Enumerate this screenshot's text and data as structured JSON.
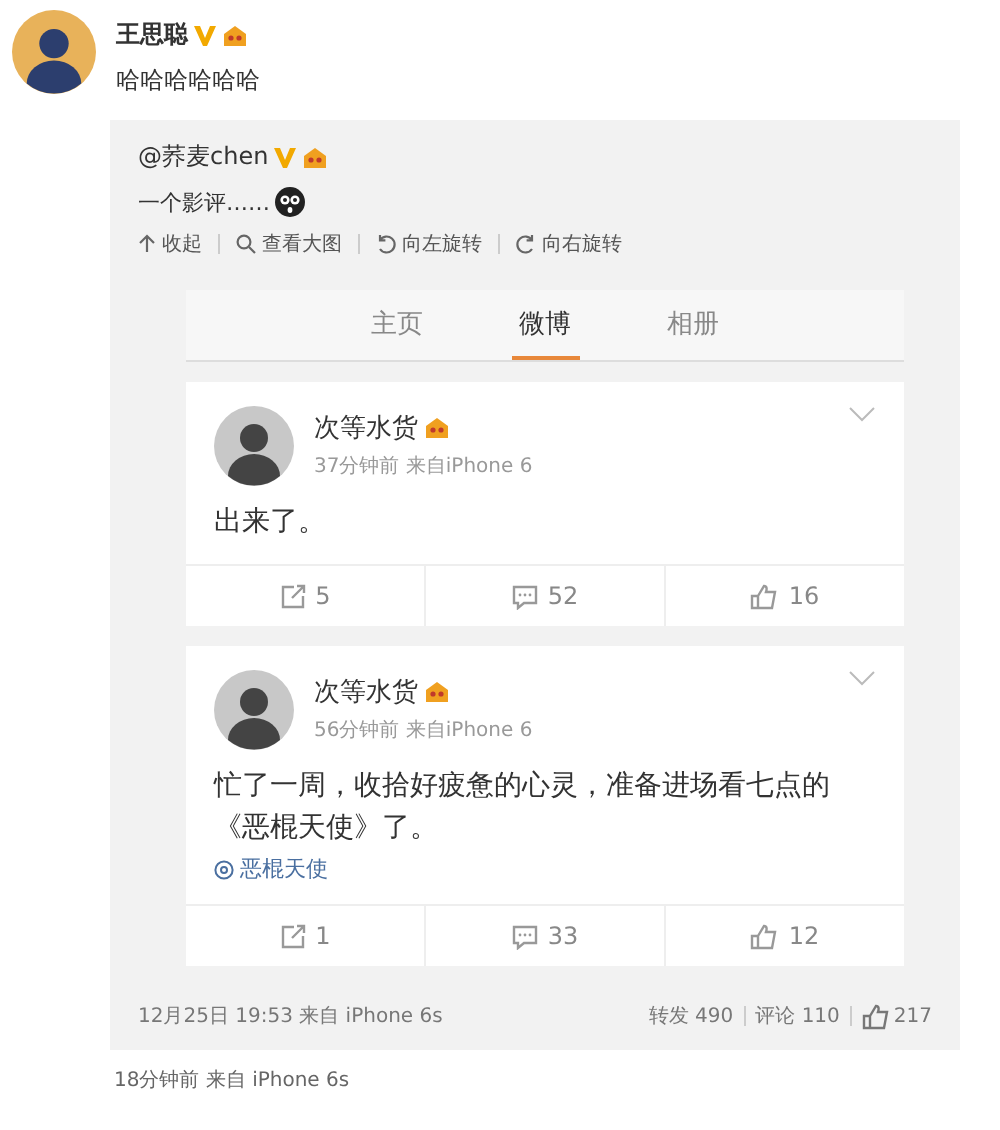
{
  "post": {
    "author": "王思聪",
    "verified": true,
    "text": "哈哈哈哈哈哈",
    "repost": {
      "author": "@荞麦chen",
      "verified": true,
      "text": "一个影评……",
      "toolbar": [
        {
          "kind": "collapse",
          "label": "收起"
        },
        {
          "kind": "zoom",
          "label": "查看大图"
        },
        {
          "kind": "rotate-left",
          "label": "向左旋转"
        },
        {
          "kind": "rotate-right",
          "label": "向右旋转"
        }
      ],
      "image": {
        "tabs": [
          {
            "label": "主页",
            "selected": false
          },
          {
            "label": "微博",
            "selected": true
          },
          {
            "label": "相册",
            "selected": false
          }
        ],
        "cards": [
          {
            "author": "次等水货",
            "meta": "37分钟前  来自iPhone 6",
            "text": "出来了。",
            "actions": [
              {
                "kind": "forward",
                "count": "5"
              },
              {
                "kind": "comment",
                "count": "52"
              },
              {
                "kind": "like",
                "count": "16"
              }
            ]
          },
          {
            "author": "次等水货",
            "meta": "56分钟前  来自iPhone 6",
            "text": "忙了一周，收拾好疲惫的心灵，准备进场看七点的《恶棍天使》了。",
            "topic": "恶棍天使",
            "actions": [
              {
                "kind": "forward",
                "count": "1"
              },
              {
                "kind": "comment",
                "count": "33"
              },
              {
                "kind": "like",
                "count": "12"
              }
            ]
          }
        ]
      },
      "footer": {
        "time": "12月25日 19:53 来自 iPhone 6s",
        "stats": [
          {
            "kind": "forward",
            "label": "转发 490"
          },
          {
            "kind": "comment",
            "label": "评论 110"
          },
          {
            "kind": "like",
            "label": "217"
          }
        ]
      }
    },
    "time": "18分钟前 来自 iPhone 6s"
  }
}
